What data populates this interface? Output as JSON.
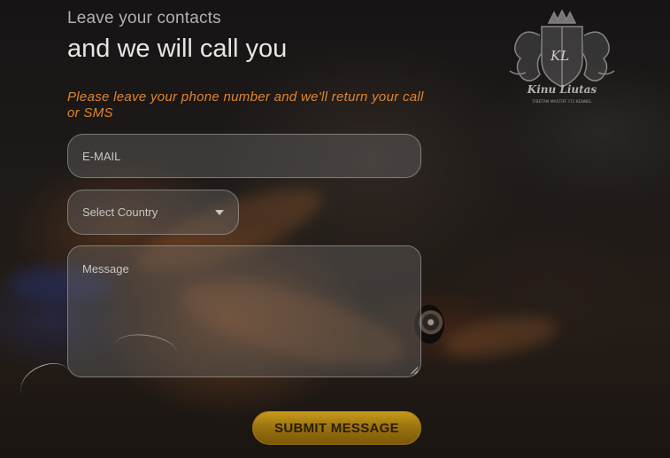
{
  "heading": {
    "subtitle": "Leave your contacts",
    "title": "and we will call you"
  },
  "notice": "Please leave your phone number and we'll return your call or SMS",
  "form": {
    "email_placeholder": "E-MAIL",
    "country_placeholder": "Select Country",
    "message_placeholder": "Message",
    "submit_label": "SUBMIT MESSAGE"
  },
  "logo": {
    "monogram": "KL",
    "name": "Kinu Liutas",
    "tagline": "TIBETAN MASTIFF FCI KENNEL"
  },
  "colors": {
    "notice": "#e0852f",
    "submit_gold": "#b08412"
  }
}
